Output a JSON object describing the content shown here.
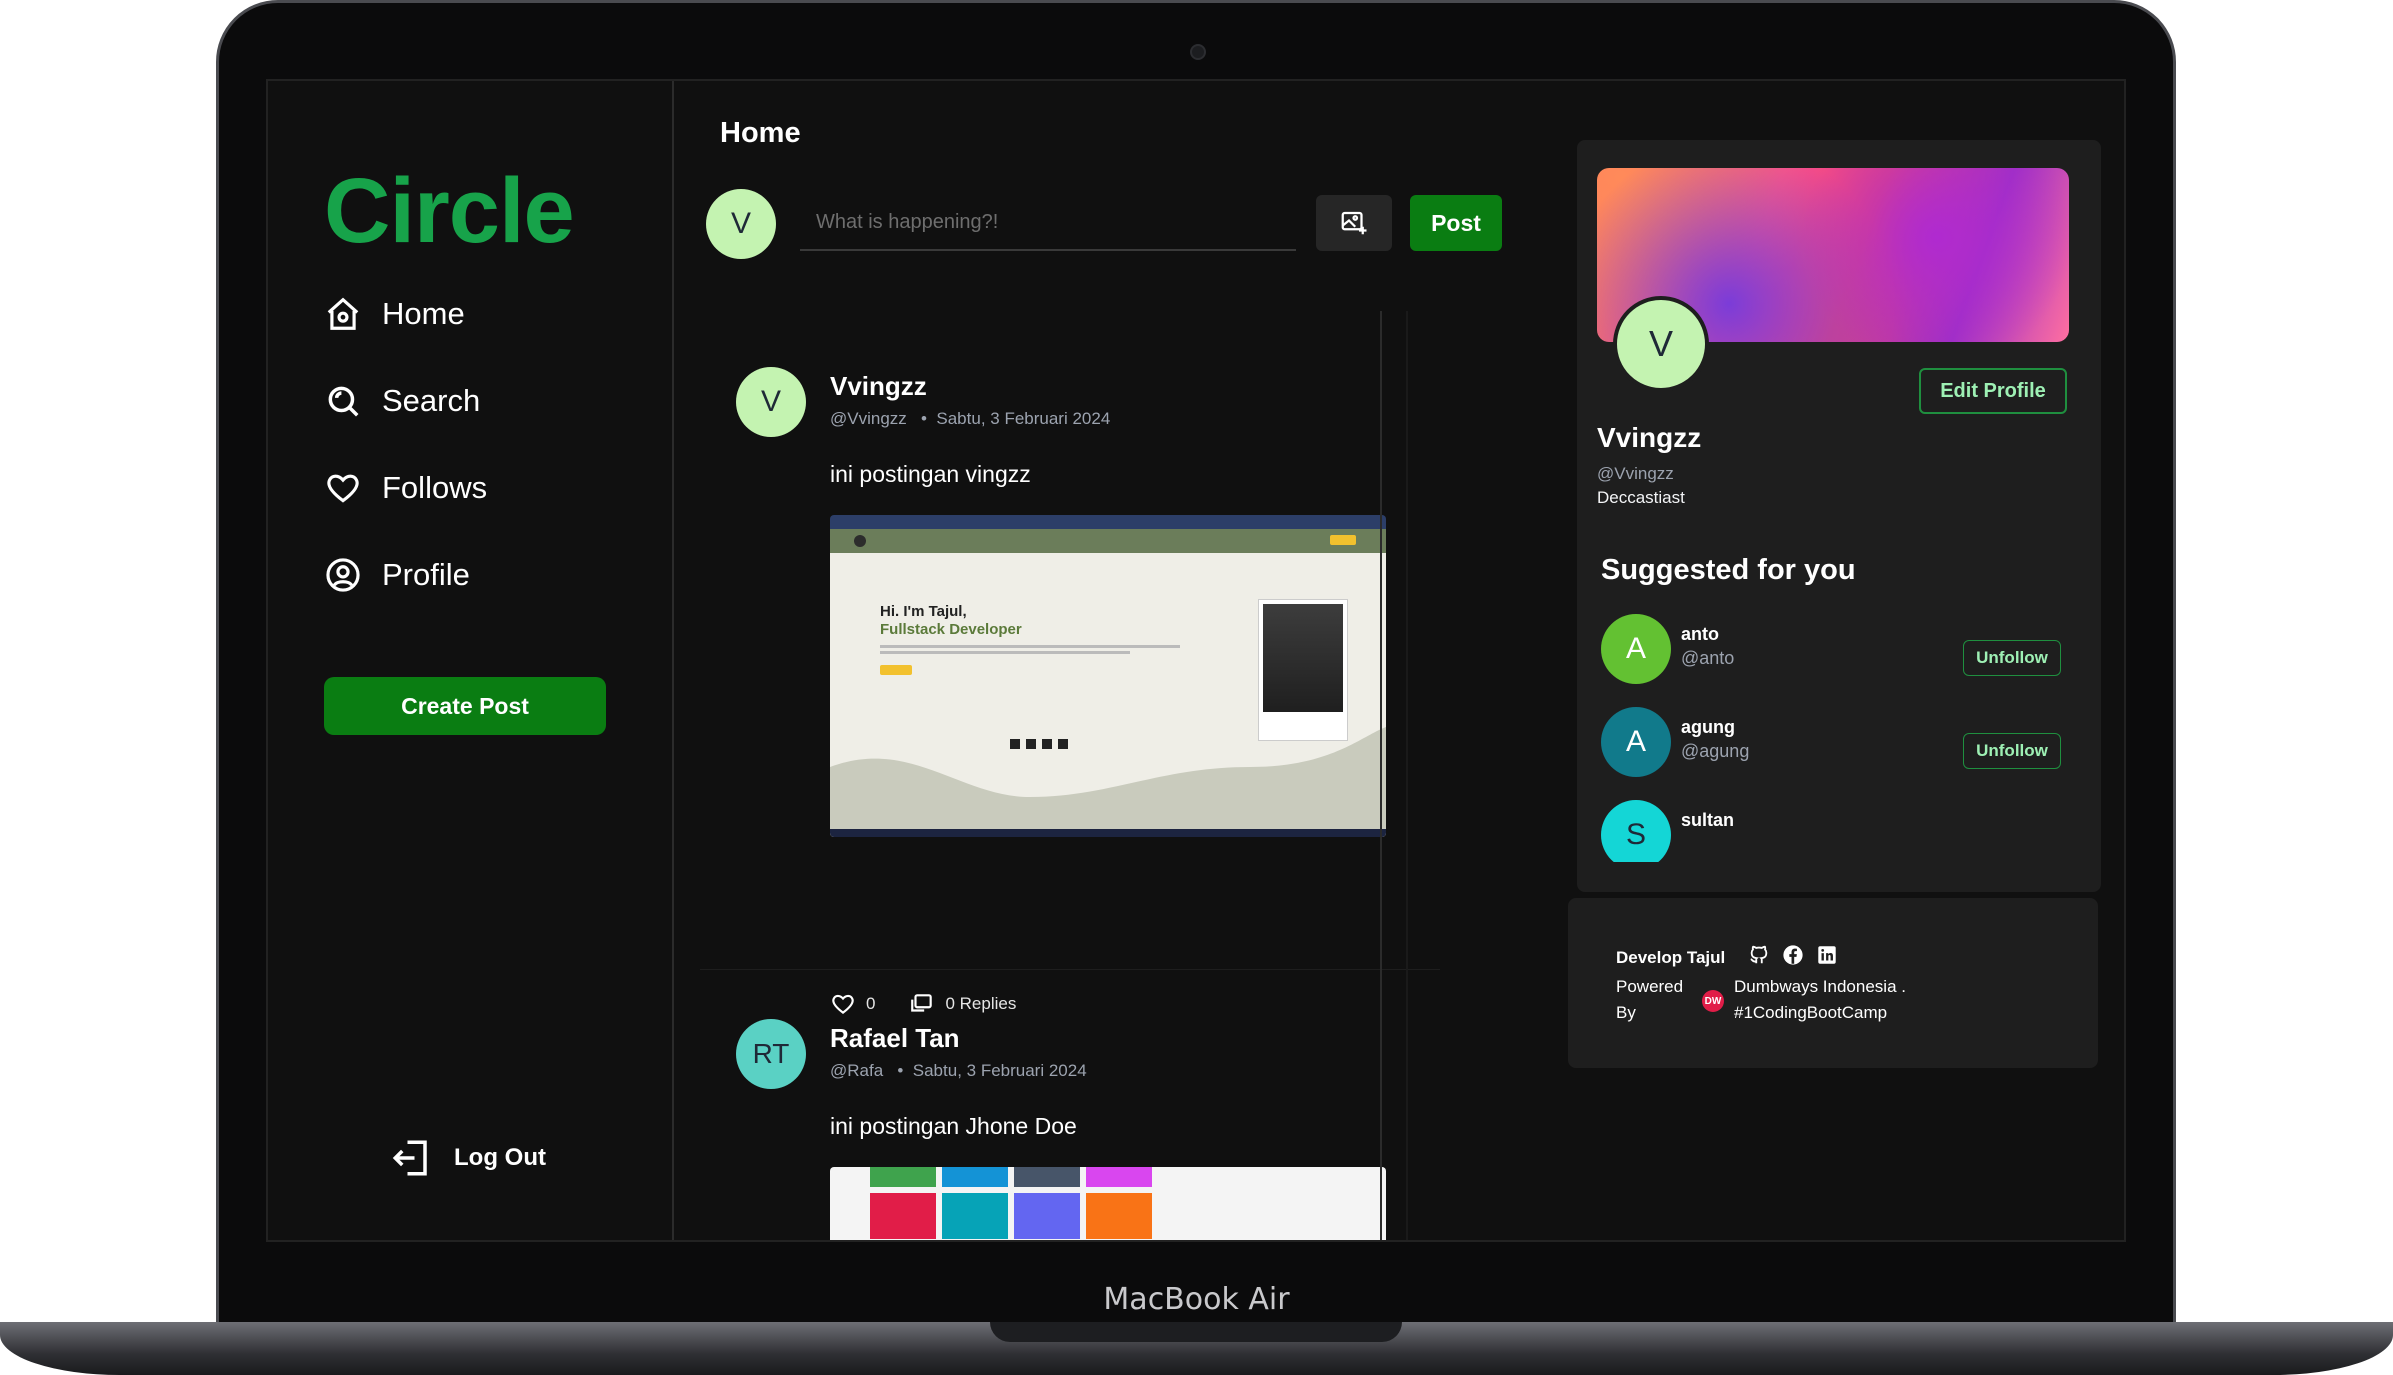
{
  "device": {
    "label": "MacBook Air"
  },
  "sidebar": {
    "logo": "Circle",
    "nav": [
      {
        "label": "Home",
        "icon": "home-icon"
      },
      {
        "label": "Search",
        "icon": "search-icon"
      },
      {
        "label": "Follows",
        "icon": "heart-icon"
      },
      {
        "label": "Profile",
        "icon": "user-circle-icon"
      }
    ],
    "create_post_label": "Create Post",
    "logout_label": "Log Out"
  },
  "main": {
    "title": "Home",
    "composer": {
      "avatar_initial": "V",
      "placeholder": "What is happening?!",
      "post_label": "Post"
    },
    "posts": [
      {
        "avatar_initial": "V",
        "avatar_color": "#c4f3b1",
        "name": "Vvingzz",
        "handle": "@Vvingzz",
        "date": "Sabtu, 3 Februari 2024",
        "text": "ini postingan vingzz",
        "likes": "0",
        "replies": "0 Replies",
        "image": {
          "hero_small": "Hi. I'm Tajul,",
          "hero_role": "Fullstack Developer"
        }
      },
      {
        "avatar_initial": "RT",
        "avatar_color": "#5ad1c4",
        "name": "Rafael Tan",
        "handle": "@Rafa",
        "date": "Sabtu, 3 Februari 2024",
        "text": "ini postingan Jhone Doe"
      }
    ]
  },
  "profile": {
    "avatar_initial": "V",
    "edit_label": "Edit Profile",
    "name": "Vvingzz",
    "handle": "@Vvingzz",
    "bio": "Deccastiast"
  },
  "suggested": {
    "title": "Suggested for you",
    "users": [
      {
        "initial": "A",
        "name": "anto",
        "handle": "@anto",
        "color": "#63c132",
        "button": "Unfollow"
      },
      {
        "initial": "A",
        "name": "agung",
        "handle": "@agung",
        "color": "#117a8b",
        "button": "Unfollow"
      },
      {
        "initial": "S",
        "name": "sultan",
        "handle": "",
        "color": "#14d6d6",
        "button": ""
      }
    ]
  },
  "footer": {
    "developer": "Develop Tajul",
    "powered_by": "Powered\nBy",
    "company": "Dumbways Indonesia .\n#1CodingBootCamp",
    "logo_text": "DW"
  },
  "colors": {
    "accent": "#0a7d12",
    "brand": "#17a34a",
    "background": "#101010"
  }
}
